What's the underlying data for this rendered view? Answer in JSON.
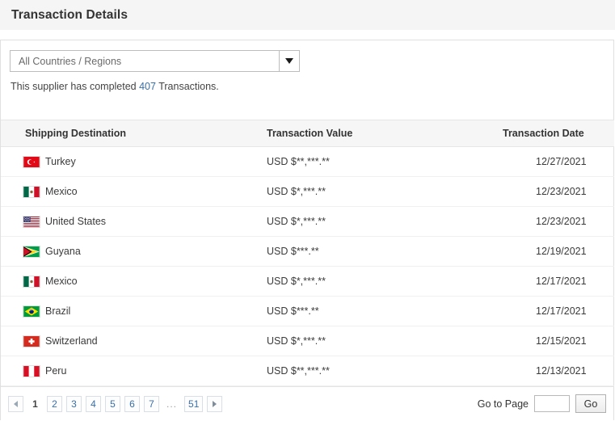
{
  "header": {
    "title": "Transaction Details"
  },
  "filter": {
    "select_value": "All Countries / Regions",
    "dropdown_icon": "chevron-down-icon"
  },
  "summary": {
    "prefix": "This supplier has completed ",
    "count": "407",
    "suffix": " Transactions."
  },
  "table": {
    "columns": [
      "Shipping Destination",
      "Transaction Value",
      "Transaction Date"
    ],
    "rows": [
      {
        "flag": "tr",
        "destination": "Turkey",
        "value": "USD $**,***.**",
        "date": "12/27/2021"
      },
      {
        "flag": "mx",
        "destination": "Mexico",
        "value": "USD $*,***.**",
        "date": "12/23/2021"
      },
      {
        "flag": "us",
        "destination": "United States",
        "value": "USD $*,***.**",
        "date": "12/23/2021"
      },
      {
        "flag": "gy",
        "destination": "Guyana",
        "value": "USD $***.**",
        "date": "12/19/2021"
      },
      {
        "flag": "mx",
        "destination": "Mexico",
        "value": "USD $*,***.**",
        "date": "12/17/2021"
      },
      {
        "flag": "br",
        "destination": "Brazil",
        "value": "USD $***.**",
        "date": "12/17/2021"
      },
      {
        "flag": "ch",
        "destination": "Switzerland",
        "value": "USD $*,***.**",
        "date": "12/15/2021"
      },
      {
        "flag": "pe",
        "destination": "Peru",
        "value": "USD $**,***.**",
        "date": "12/13/2021"
      }
    ]
  },
  "pagination": {
    "prev_icon": "chevron-left-icon",
    "next_icon": "chevron-right-icon",
    "current_page": "1",
    "pages": [
      "2",
      "3",
      "4",
      "5",
      "6",
      "7"
    ],
    "ellipsis": "...",
    "last_page": "51",
    "goto_label": "Go to Page",
    "goto_value": "",
    "go_label": "Go"
  },
  "colors": {
    "link": "#3b6ea5",
    "title_bar_bg": "#f5f5f5",
    "table_header_bg": "#f6f6f6"
  }
}
